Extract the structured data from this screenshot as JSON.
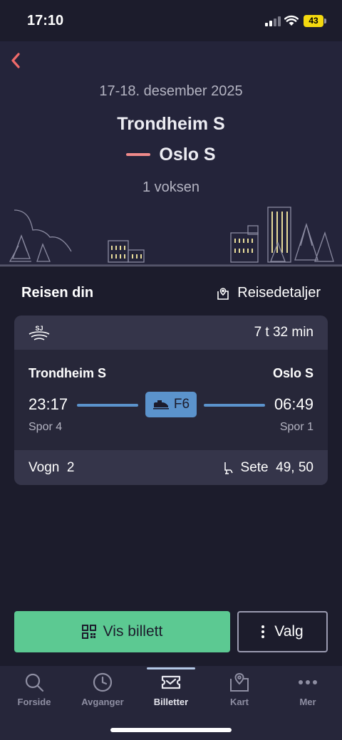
{
  "status_bar": {
    "time": "17:10",
    "battery": "43"
  },
  "header": {
    "date": "17-18. desember 2025",
    "from": "Trondheim S",
    "to": "Oslo S",
    "passengers": "1 voksen"
  },
  "section": {
    "title": "Reisen din",
    "details_link": "Reisedetaljer"
  },
  "trip": {
    "operator": "SJ",
    "duration": "7 t 32 min",
    "origin": "Trondheim S",
    "destination": "Oslo S",
    "departure": "23:17",
    "arrival": "06:49",
    "train_line": "F6",
    "departure_track": "Spor 4",
    "arrival_track": "Spor 1",
    "wagon_label": "Vogn",
    "wagon": "2",
    "seat_label": "Sete",
    "seats": "49, 50"
  },
  "actions": {
    "show_ticket": "Vis billett",
    "options": "Valg"
  },
  "tabs": [
    {
      "label": "Forside",
      "icon": "search-icon"
    },
    {
      "label": "Avganger",
      "icon": "clock-icon"
    },
    {
      "label": "Billetter",
      "icon": "ticket-icon",
      "active": true
    },
    {
      "label": "Kart",
      "icon": "map-pin-icon"
    },
    {
      "label": "Mer",
      "icon": "more-icon"
    }
  ],
  "colors": {
    "background": "#1c1c2c",
    "header": "#24243a",
    "accent_green": "#5cc992",
    "accent_blue": "#5b93cc",
    "accent_red": "#ef8a8a"
  }
}
